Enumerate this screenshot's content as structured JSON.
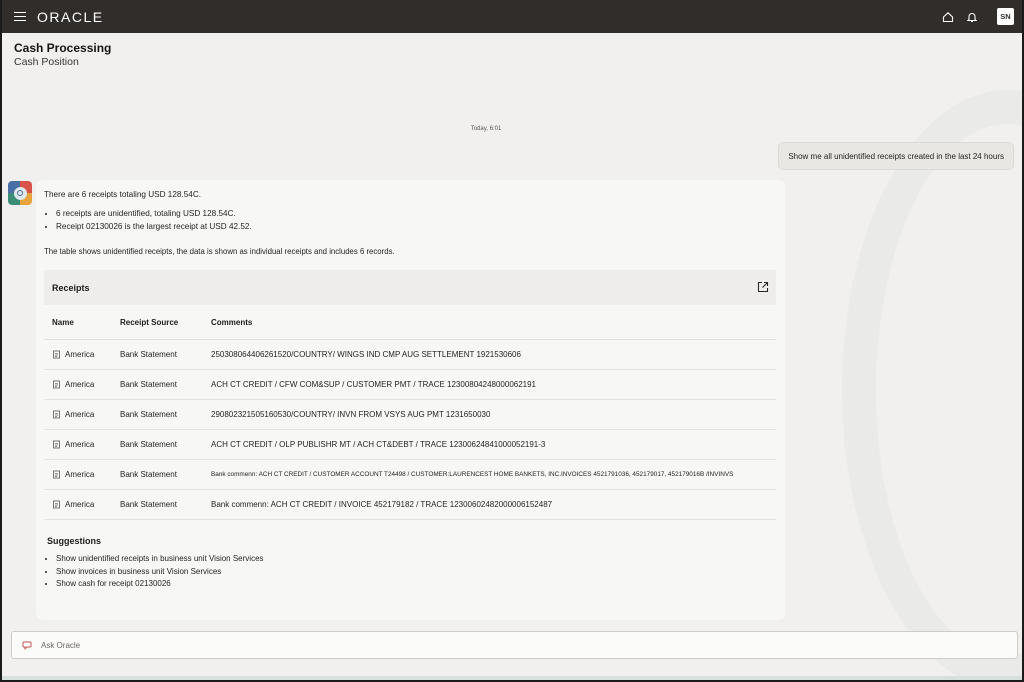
{
  "header": {
    "logo": "ORACLE",
    "avatar_initials": "SN"
  },
  "page": {
    "title": "Cash Processing",
    "subtitle": "Cash Position"
  },
  "conversation": {
    "timestamp": "Today, 6:01",
    "user_message": "Show me all unidentified receipts created in the last 24 hours",
    "bot": {
      "summary": "There are 6 receipts totaling USD 128.54C.",
      "bullets": [
        "6 receipts are unidentified, totaling USD 128.54C.",
        "Receipt 02130026 is the largest receipt at USD 42.52."
      ],
      "table_description": "The table shows unidentified receipts, the data is shown as individual receipts and includes 6 records.",
      "table": {
        "title": "Receipts",
        "columns": [
          "Name",
          "Receipt Source",
          "Comments"
        ],
        "rows": [
          {
            "name": "America",
            "source": "Bank Statement",
            "comments": "250308064406261520/COUNTRY/ WINGS IND CMP AUG SETTLEMENT 1921530606"
          },
          {
            "name": "America",
            "source": "Bank Statement",
            "comments": "ACH CT CREDIT / CFW COM&SUP / CUSTOMER PMT / TRACE 12300804248000062191"
          },
          {
            "name": "America",
            "source": "Bank Statement",
            "comments": "290802321505160530/COUNTRY/ INVN FROM VSYS AUG PMT 1231650030"
          },
          {
            "name": "America",
            "source": "Bank Statement",
            "comments": "ACH CT CREDIT / OLP PUBLISHR MT / ACH CT&DEBT / TRACE 12300624841000052191-3"
          },
          {
            "name": "America",
            "source": "Bank Statement",
            "comments": "Bank commenn:  ACH CT CREDIT / CUSTOMER ACCOUNT T24498 / CUSTOMER:LAURENCEST HOME BANKETS, INC.INVOICES 4521791036, 452179017, 452179016B /INVINVS"
          },
          {
            "name": "America",
            "source": "Bank Statement",
            "comments": "Bank commenn: ACH CT CREDIT / INVOICE 452179182 / TRACE 12300602482000006152487"
          }
        ]
      },
      "suggestions_title": "Suggestions",
      "suggestions": [
        "Show unidentified receipts in business unit Vision Services",
        "Show invoices in business unit Vision Services",
        "Show cash for receipt 02130026"
      ]
    }
  },
  "ask": {
    "placeholder": "Ask Oracle"
  },
  "colors": {
    "topbar": "#312d2a",
    "background": "#f1f0ef",
    "card": "#f7f7f6"
  }
}
